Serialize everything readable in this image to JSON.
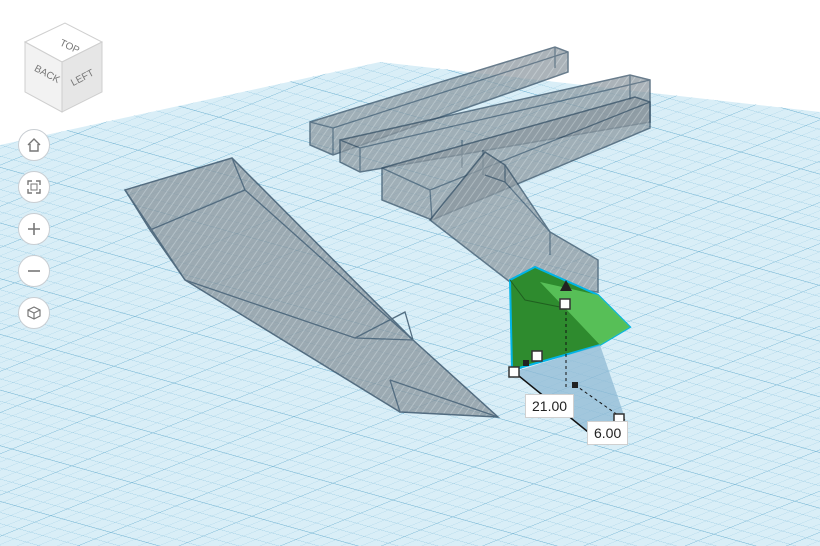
{
  "view_cube": {
    "top_label": "TOP",
    "back_label": "BACK",
    "left_label": "LEFT"
  },
  "nav": {
    "home_icon": "home-icon",
    "fit_icon": "fit-all-icon",
    "zoom_in_icon": "zoom-in-icon",
    "zoom_out_icon": "zoom-out-icon",
    "view_mode_icon": "perspective-icon"
  },
  "dimensions": {
    "length": "21.00",
    "width": "6.00"
  },
  "colors": {
    "grid_bg": "#d9eef7",
    "grid_line": "#8fc6df",
    "grid_major": "#6fb2d1",
    "hole_fill": "#9aa6ad",
    "hole_stroke": "#2f4a60",
    "selected_fill": "#2e8b2e",
    "selected_highlight": "#5cc45c",
    "selection_outline": "#00b4e6"
  }
}
